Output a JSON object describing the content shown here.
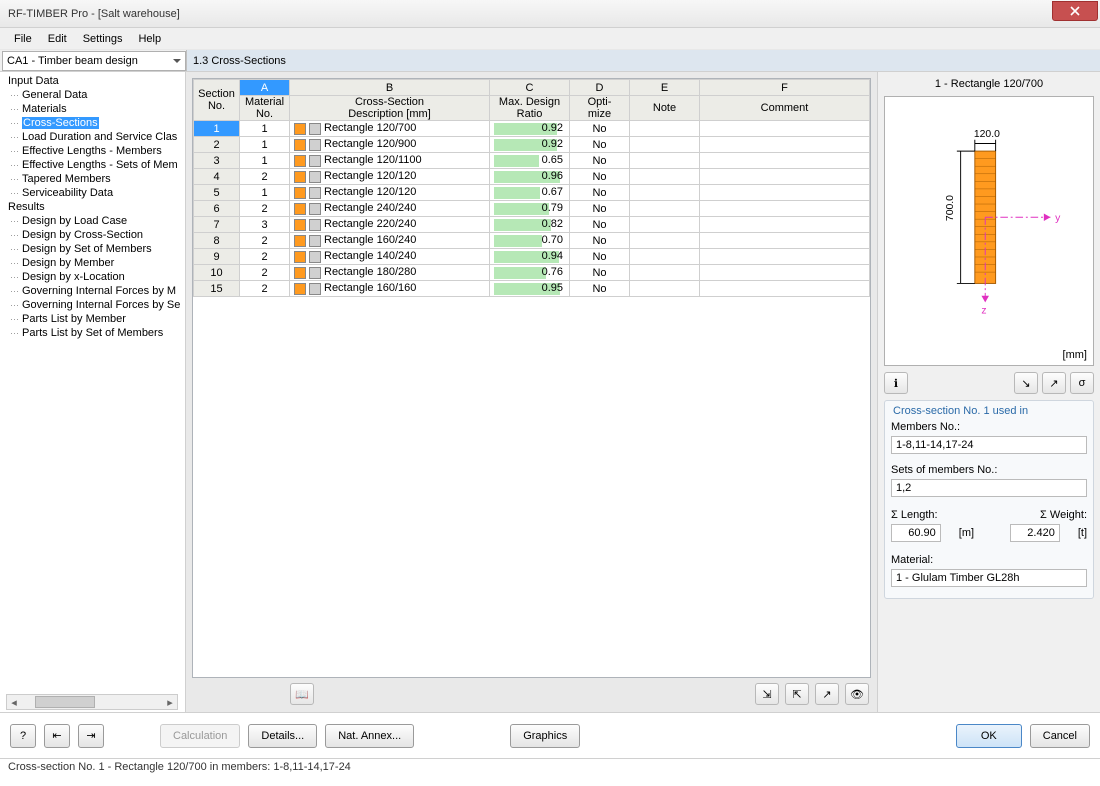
{
  "window": {
    "title": "RF-TIMBER Pro - [Salt warehouse]"
  },
  "menu": {
    "file": "File",
    "edit": "Edit",
    "settings": "Settings",
    "help": "Help"
  },
  "case_select": "CA1 - Timber beam design",
  "panel_title": "1.3 Cross-Sections",
  "tree": {
    "input": "Input Data",
    "input_items": [
      "General Data",
      "Materials",
      "Cross-Sections",
      "Load Duration and Service Clas",
      "Effective Lengths - Members",
      "Effective Lengths - Sets of Mem",
      "Tapered Members",
      "Serviceability Data"
    ],
    "results": "Results",
    "results_items": [
      "Design by Load Case",
      "Design by Cross-Section",
      "Design by Set of Members",
      "Design by Member",
      "Design by x-Location",
      "Governing Internal Forces by M",
      "Governing Internal Forces by Se",
      "Parts List by Member",
      "Parts List by Set of Members"
    ]
  },
  "grid": {
    "letters": [
      "A",
      "B",
      "C",
      "D",
      "E",
      "F"
    ],
    "headers": {
      "section_no": "Section\nNo.",
      "material_no": "Material\nNo.",
      "desc": "Cross-Section\nDescription [mm]",
      "ratio": "Max. Design\nRatio",
      "optimize": "Opti-\nmize",
      "note": "Note",
      "comment": "Comment"
    },
    "rows": [
      {
        "no": "1",
        "mat": "1",
        "desc": "Rectangle 120/700",
        "ratio": "0.92",
        "opt": "No"
      },
      {
        "no": "2",
        "mat": "1",
        "desc": "Rectangle 120/900",
        "ratio": "0.92",
        "opt": "No"
      },
      {
        "no": "3",
        "mat": "1",
        "desc": "Rectangle 120/1100",
        "ratio": "0.65",
        "opt": "No"
      },
      {
        "no": "4",
        "mat": "2",
        "desc": "Rectangle 120/120",
        "ratio": "0.96",
        "opt": "No"
      },
      {
        "no": "5",
        "mat": "1",
        "desc": "Rectangle 120/120",
        "ratio": "0.67",
        "opt": "No"
      },
      {
        "no": "6",
        "mat": "2",
        "desc": "Rectangle 240/240",
        "ratio": "0.79",
        "opt": "No"
      },
      {
        "no": "7",
        "mat": "3",
        "desc": "Rectangle 220/240",
        "ratio": "0.82",
        "opt": "No"
      },
      {
        "no": "8",
        "mat": "2",
        "desc": "Rectangle 160/240",
        "ratio": "0.70",
        "opt": "No"
      },
      {
        "no": "9",
        "mat": "2",
        "desc": "Rectangle 140/240",
        "ratio": "0.94",
        "opt": "No"
      },
      {
        "no": "10",
        "mat": "2",
        "desc": "Rectangle 180/280",
        "ratio": "0.76",
        "opt": "No"
      },
      {
        "no": "15",
        "mat": "2",
        "desc": "Rectangle 160/160",
        "ratio": "0.95",
        "opt": "No"
      }
    ]
  },
  "preview": {
    "title": "1 - Rectangle 120/700",
    "width_label": "120.0",
    "height_label": "700.0",
    "y_axis": "y",
    "z_axis": "z",
    "unit": "[mm]"
  },
  "info": {
    "group_title": "Cross-section No. 1 used in",
    "members_label": "Members No.:",
    "members_value": "1-8,11-14,17-24",
    "sets_label": "Sets of members No.:",
    "sets_value": "1,2",
    "length_label": "Σ Length:",
    "length_value": "60.90",
    "length_unit": "[m]",
    "weight_label": "Σ Weight:",
    "weight_value": "2.420",
    "weight_unit": "[t]",
    "material_label": "Material:",
    "material_value": "1 - Glulam Timber GL28h"
  },
  "buttons": {
    "calculation": "Calculation",
    "details": "Details...",
    "nat_annex": "Nat. Annex...",
    "graphics": "Graphics",
    "ok": "OK",
    "cancel": "Cancel"
  },
  "status": "Cross-section No. 1 - Rectangle 120/700 in members: 1-8,11-14,17-24"
}
